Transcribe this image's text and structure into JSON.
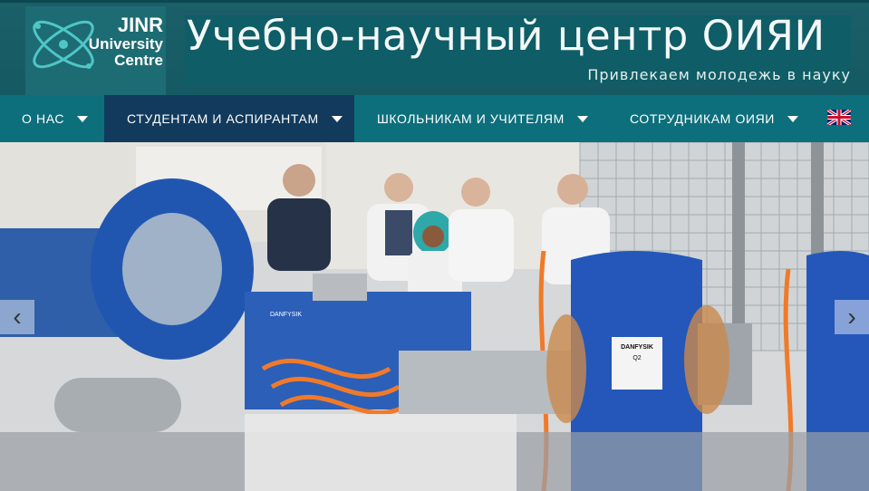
{
  "logo": {
    "line1": "JINR",
    "line2": "University",
    "line3": "Centre"
  },
  "header": {
    "title": "Учебно-научный центр ОИЯИ",
    "tagline": "Привлекаем молодежь в науку"
  },
  "nav": {
    "items": [
      {
        "label": "О НАС"
      },
      {
        "label": "СТУДЕНТАМ И АСПИРАНТАМ"
      },
      {
        "label": "ШКОЛЬНИКАМ И УЧИТЕЛЯМ"
      },
      {
        "label": "СОТРУДНИКАМ ОИЯИ"
      }
    ],
    "active_index": 1,
    "language_icon": "uk-flag-icon"
  },
  "slider": {
    "prev_icon": "chevron-left-icon",
    "next_icon": "chevron-right-icon",
    "prev_glyph": "‹",
    "next_glyph": "›",
    "magnet_label_brand": "DANFYSIK",
    "magnet_label_id": "Q2",
    "magnet_left_brand": "DANFYSIK"
  },
  "colors": {
    "header_bg": "#155a63",
    "nav_bg": "#0d6f7c",
    "nav_active_bg": "#123a5c",
    "magnet_blue": "#1f4fa8"
  }
}
